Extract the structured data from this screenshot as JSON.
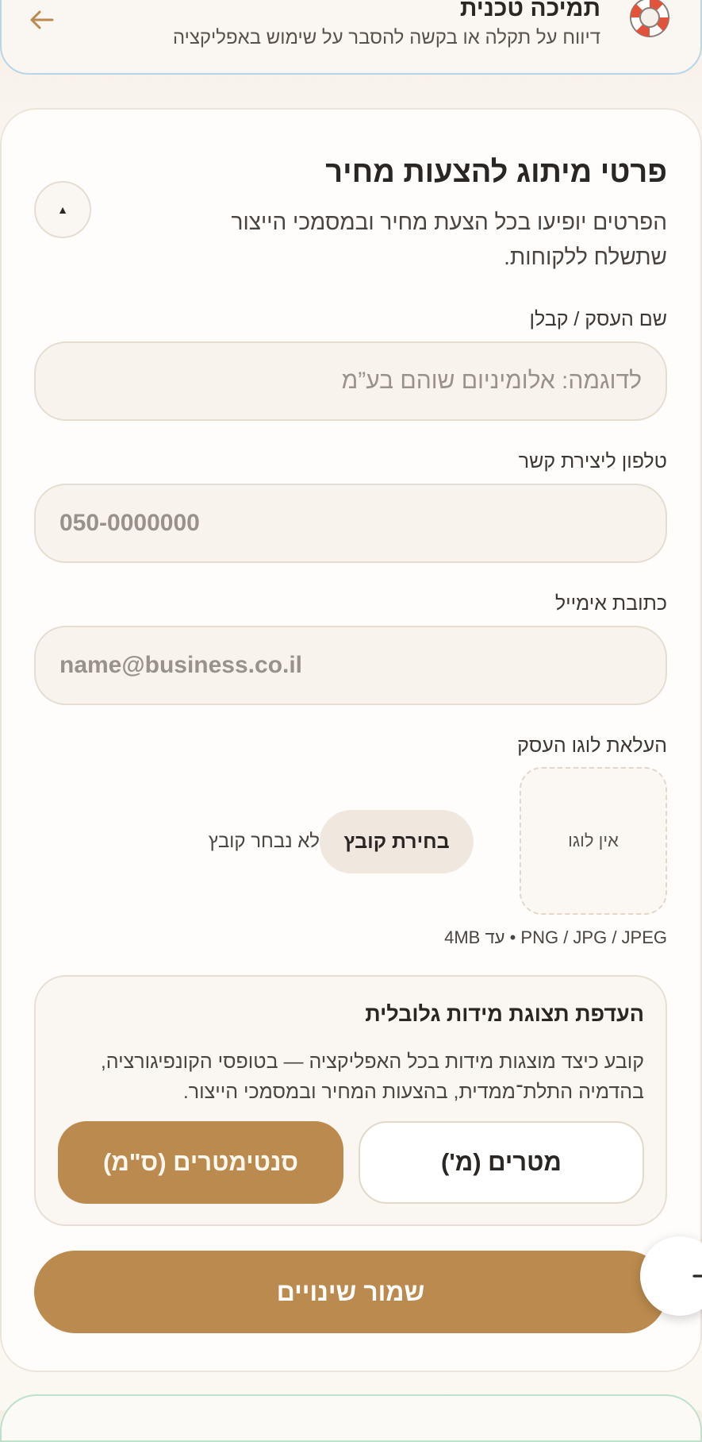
{
  "support": {
    "title": "תמיכה טכנית",
    "subtitle": "דיווח על תקלה או בקשה להסבר על שימוש באפליקציה"
  },
  "section": {
    "title": "פרטי מיתוג להצעות מחיר",
    "description": "הפרטים יופיעו בכל הצעת מחיר ובמסמכי הייצור שתשלח ללקוחות.",
    "collapse_glyph": "▲"
  },
  "fields": {
    "business_name": {
      "label": "שם העסק / קבלן",
      "placeholder": "לדוגמה: אלומיניום שוהם בע”מ",
      "value": ""
    },
    "phone": {
      "label": "טלפון ליצירת קשר",
      "placeholder": "050-0000000",
      "value": ""
    },
    "email": {
      "label": "כתובת אימייל",
      "placeholder": "name@business.co.il",
      "value": ""
    }
  },
  "logo_upload": {
    "label": "העלאת לוגו העסק",
    "empty_text": "אין לוגו",
    "choose_button": "בחירת קובץ",
    "no_file_text": "לא נבחר קובץ",
    "hint": "PNG / JPG / JPEG • עד 4MB"
  },
  "unit_pref": {
    "title": "העדפת תצוגת מידות גלובלית",
    "description": "קובע כיצד מוצגות מידות בכל האפליקציה — בטופסי הקונפיגורציה, בהדמיה התלת־ממדית, בהצעות המחיר ובמסמכי הייצור.",
    "meters_label": "מטרים (מ')",
    "cm_label": "סנטימטרים (ס\"מ)",
    "selected": "cm"
  },
  "save_label": "שמור שינויים",
  "icons": {
    "back": "arrow-left-icon",
    "support": "lifebuoy-icon",
    "next": "arrow-right-icon"
  },
  "colors": {
    "accent": "#bb8a4e",
    "support_border": "#b9d6e6",
    "bottom_card_border": "#bfe0cc"
  }
}
